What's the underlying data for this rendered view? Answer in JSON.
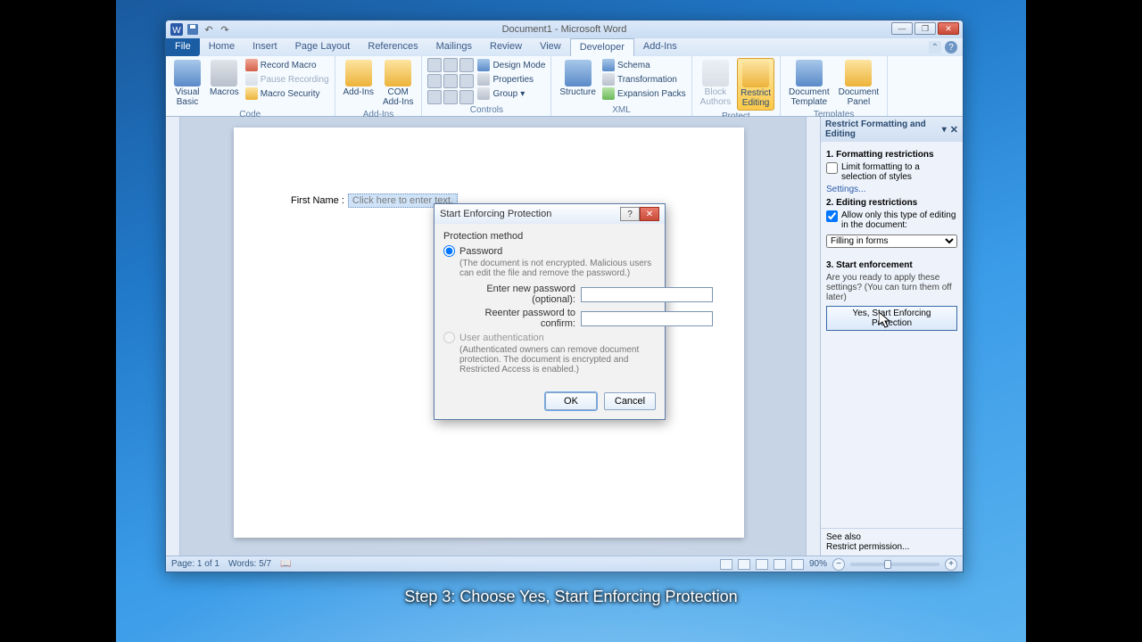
{
  "caption": "Step 3: Choose Yes, Start Enforcing Protection",
  "title": "Document1 - Microsoft Word",
  "tabs": {
    "file": "File",
    "home": "Home",
    "insert": "Insert",
    "pagelayout": "Page Layout",
    "references": "References",
    "mailings": "Mailings",
    "review": "Review",
    "view": "View",
    "developer": "Developer",
    "addins": "Add-Ins"
  },
  "ribbon": {
    "code": {
      "label": "Code",
      "visual_basic": "Visual\nBasic",
      "macros": "Macros",
      "record": "Record Macro",
      "pause": "Pause Recording",
      "security": "Macro Security"
    },
    "addins": {
      "label": "Add-Ins",
      "addins": "Add-Ins",
      "com": "COM\nAdd-Ins"
    },
    "controls": {
      "label": "Controls",
      "design": "Design Mode",
      "properties": "Properties",
      "group": "Group"
    },
    "xml": {
      "label": "XML",
      "structure": "Structure",
      "schema": "Schema",
      "transformation": "Transformation",
      "expansion": "Expansion Packs"
    },
    "protect": {
      "label": "Protect",
      "block": "Block\nAuthors",
      "restrict": "Restrict\nEditing"
    },
    "templates": {
      "label": "Templates",
      "template": "Document\nTemplate",
      "panel": "Document\nPanel"
    }
  },
  "doc": {
    "field_label": "First Name :",
    "placeholder": "Click here to enter text."
  },
  "pane": {
    "title": "Restrict Formatting and Editing",
    "s1": "1. Formatting restrictions",
    "s1_cb": "Limit formatting to a selection of styles",
    "s1_link": "Settings...",
    "s2": "2. Editing restrictions",
    "s2_cb": "Allow only this type of editing in the document:",
    "s2_opt": "Filling in forms",
    "s3": "3. Start enforcement",
    "s3_txt": "Are you ready to apply these settings? (You can turn them off later)",
    "s3_btn": "Yes, Start Enforcing Protection",
    "seealso": "See also",
    "restrict_link": "Restrict permission..."
  },
  "dialog": {
    "title": "Start Enforcing Protection",
    "method": "Protection method",
    "pwd": "Password",
    "pwd_note": "(The document is not encrypted. Malicious users can edit the file and remove the password.)",
    "enter": "Enter new password (optional):",
    "reenter": "Reenter password to confirm:",
    "userauth": "User authentication",
    "userauth_note": "(Authenticated owners can remove document protection. The document is encrypted and Restricted Access is enabled.)",
    "ok": "OK",
    "cancel": "Cancel"
  },
  "status": {
    "page": "Page: 1 of 1",
    "words": "Words: 5/7",
    "zoom": "90%"
  }
}
